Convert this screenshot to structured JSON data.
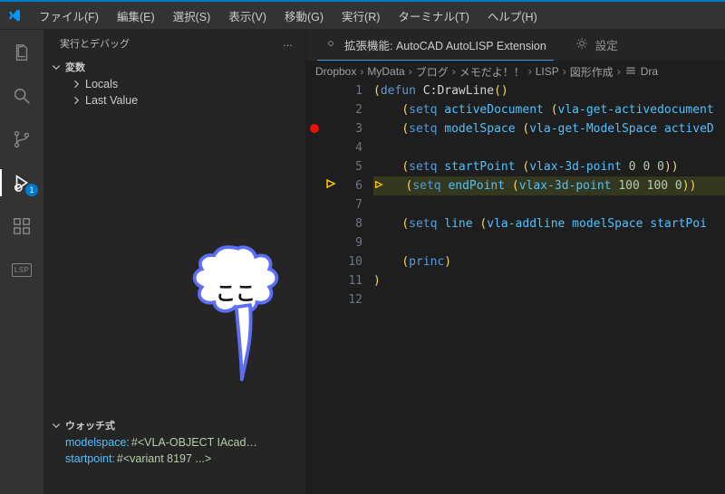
{
  "menubar": {
    "items": [
      "ファイル(F)",
      "編集(E)",
      "選択(S)",
      "表示(V)",
      "移動(G)",
      "実行(R)",
      "ターミナル(T)",
      "ヘルプ(H)"
    ]
  },
  "activitybar": {
    "explorer": "explorer",
    "search": "search",
    "scm": "source-control",
    "debug": "run-debug",
    "debug_badge": "1",
    "extensions": "extensions",
    "lsp": "LSP"
  },
  "sidepanel": {
    "title": "実行とデバッグ",
    "more": "…",
    "sections": {
      "variables": {
        "label": "変数",
        "locals": "Locals",
        "lastvalue": "Last Value"
      },
      "watch": {
        "label": "ウォッチ式",
        "items": [
          {
            "name": "modelspace:",
            "value": "#<VLA-OBJECT IAcad…"
          },
          {
            "name": "startpoint:",
            "value": "#<variant 8197 ...>"
          }
        ]
      }
    }
  },
  "tabs": {
    "ext": {
      "label": "拡張機能: AutoCAD AutoLISP Extension"
    },
    "settings": {
      "label": "設定"
    }
  },
  "breadcrumb": [
    "Dropbox",
    "MyData",
    "ブログ",
    "メモだよ！！",
    "LISP",
    "図形作成",
    "Dra"
  ],
  "editor": {
    "breakpoint_line": 3,
    "current_line": 6,
    "lines": [
      {
        "n": 1,
        "tokens": [
          {
            "t": "p",
            "v": "("
          },
          {
            "t": "kw",
            "v": "defun"
          },
          {
            "t": "id",
            "v": " C:DrawLine"
          },
          {
            "t": "p",
            "v": "()"
          }
        ]
      },
      {
        "n": 2,
        "tokens": [
          {
            "t": "id",
            "v": "    "
          },
          {
            "t": "p",
            "v": "("
          },
          {
            "t": "kw",
            "v": "setq"
          },
          {
            "t": "id",
            "v": " "
          },
          {
            "t": "fn",
            "v": "activeDocument"
          },
          {
            "t": "id",
            "v": " "
          },
          {
            "t": "p",
            "v": "("
          },
          {
            "t": "fn",
            "v": "vla-get-activedocument"
          }
        ]
      },
      {
        "n": 3,
        "tokens": [
          {
            "t": "id",
            "v": "    "
          },
          {
            "t": "p",
            "v": "("
          },
          {
            "t": "kw",
            "v": "setq"
          },
          {
            "t": "id",
            "v": " "
          },
          {
            "t": "fn",
            "v": "modelSpace"
          },
          {
            "t": "id",
            "v": " "
          },
          {
            "t": "p",
            "v": "("
          },
          {
            "t": "fn",
            "v": "vla-get-ModelSpace"
          },
          {
            "t": "id",
            "v": " "
          },
          {
            "t": "fn",
            "v": "activeD"
          }
        ]
      },
      {
        "n": 4,
        "tokens": []
      },
      {
        "n": 5,
        "tokens": [
          {
            "t": "id",
            "v": "    "
          },
          {
            "t": "p",
            "v": "("
          },
          {
            "t": "kw",
            "v": "setq"
          },
          {
            "t": "id",
            "v": " "
          },
          {
            "t": "fn",
            "v": "startPoint"
          },
          {
            "t": "id",
            "v": " "
          },
          {
            "t": "p",
            "v": "("
          },
          {
            "t": "fn",
            "v": "vlax-3d-point"
          },
          {
            "t": "id",
            "v": " "
          },
          {
            "t": "nm",
            "v": "0 0 0"
          },
          {
            "t": "p",
            "v": "))"
          }
        ]
      },
      {
        "n": 6,
        "tokens": [
          {
            "t": "id",
            "v": "   "
          },
          {
            "t": "p",
            "v": "("
          },
          {
            "t": "kw",
            "v": "setq"
          },
          {
            "t": "id",
            "v": " "
          },
          {
            "t": "fn",
            "v": "endPoint"
          },
          {
            "t": "id",
            "v": " "
          },
          {
            "t": "p",
            "v": "("
          },
          {
            "t": "fn",
            "v": "vlax-3d-point"
          },
          {
            "t": "id",
            "v": " "
          },
          {
            "t": "nm",
            "v": "100 100 0"
          },
          {
            "t": "p",
            "v": "))"
          }
        ]
      },
      {
        "n": 7,
        "tokens": []
      },
      {
        "n": 8,
        "tokens": [
          {
            "t": "id",
            "v": "    "
          },
          {
            "t": "p",
            "v": "("
          },
          {
            "t": "kw",
            "v": "setq"
          },
          {
            "t": "id",
            "v": " "
          },
          {
            "t": "fn",
            "v": "line"
          },
          {
            "t": "id",
            "v": " "
          },
          {
            "t": "p",
            "v": "("
          },
          {
            "t": "fn",
            "v": "vla-addline"
          },
          {
            "t": "id",
            "v": " "
          },
          {
            "t": "fn",
            "v": "modelSpace"
          },
          {
            "t": "id",
            "v": " "
          },
          {
            "t": "fn",
            "v": "startPoi"
          }
        ]
      },
      {
        "n": 9,
        "tokens": []
      },
      {
        "n": 10,
        "tokens": [
          {
            "t": "id",
            "v": "    "
          },
          {
            "t": "p",
            "v": "("
          },
          {
            "t": "kw",
            "v": "princ"
          },
          {
            "t": "p",
            "v": ")"
          }
        ]
      },
      {
        "n": 11,
        "tokens": [
          {
            "t": "p",
            "v": ")"
          }
        ]
      },
      {
        "n": 12,
        "tokens": []
      }
    ]
  },
  "annotation": {
    "text": "ここ"
  }
}
